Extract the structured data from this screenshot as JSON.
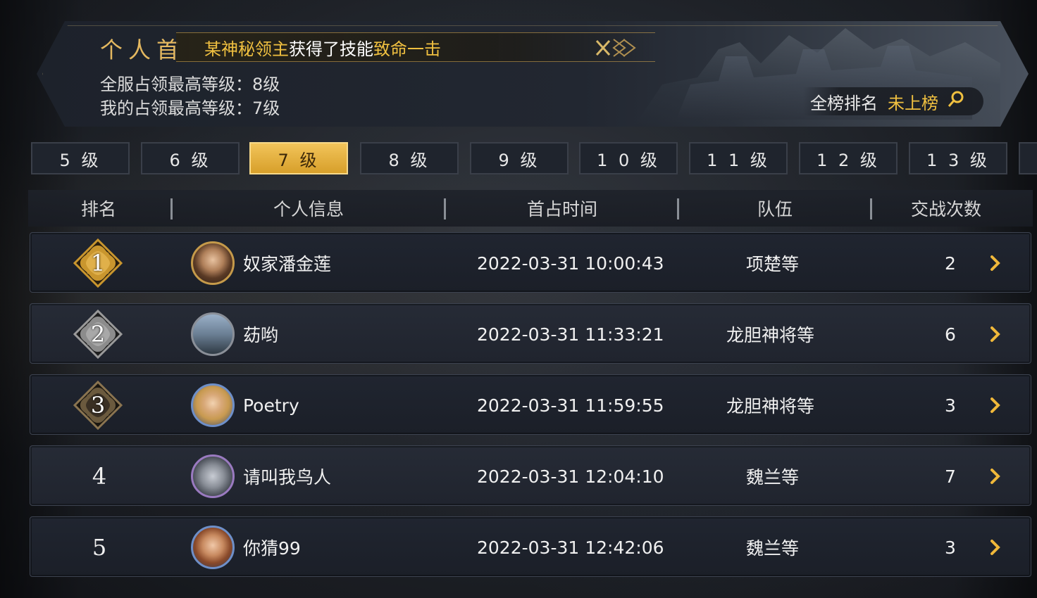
{
  "banner": {
    "title": "个人首",
    "notice_prefix": "某神秘领主",
    "notice_middle": "获得了技能",
    "notice_skill": "致命一击",
    "server_max_label": "全服占领最高等级：8级",
    "my_max_label": "我的占领最高等级：7级",
    "overall_rank_label": "全榜排名",
    "overall_rank_value": "未上榜"
  },
  "tabs": [
    "5 级",
    "6 级",
    "7 级",
    "8 级",
    "9 级",
    "1 0 级",
    "1 1 级",
    "1 2 级",
    "1 3 级"
  ],
  "active_tab": "7 级",
  "table": {
    "headers": [
      "排名",
      "个人信息",
      "首占时间",
      "队伍",
      "交战次数"
    ],
    "rows": [
      {
        "rank": "1",
        "name": "奴家潘金莲",
        "time": "2022-03-31 10:00:43",
        "team": "项楚等",
        "battles": "2"
      },
      {
        "rank": "2",
        "name": "苭哟",
        "time": "2022-03-31 11:33:21",
        "team": "龙胆神将等",
        "battles": "6"
      },
      {
        "rank": "3",
        "name": "Poetry",
        "time": "2022-03-31 11:59:55",
        "team": "龙胆神将等",
        "battles": "3"
      },
      {
        "rank": "4",
        "name": "请叫我鸟人",
        "time": "2022-03-31 12:04:10",
        "team": "魏兰等",
        "battles": "7"
      },
      {
        "rank": "5",
        "name": "你猜99",
        "time": "2022-03-31 12:42:06",
        "team": "魏兰等",
        "battles": "3"
      }
    ]
  },
  "icons": {
    "search": "magnifier-icon",
    "close": "close-icon",
    "chevron": "chevron-right-icon",
    "medal": "medal-icon"
  },
  "colors": {
    "gold": "#f0c040",
    "active_tab": "#e5b246",
    "medal_gold": "#c9962e",
    "medal_silver": "#8c8c8c",
    "medal_bronze": "#6b5a3e"
  }
}
